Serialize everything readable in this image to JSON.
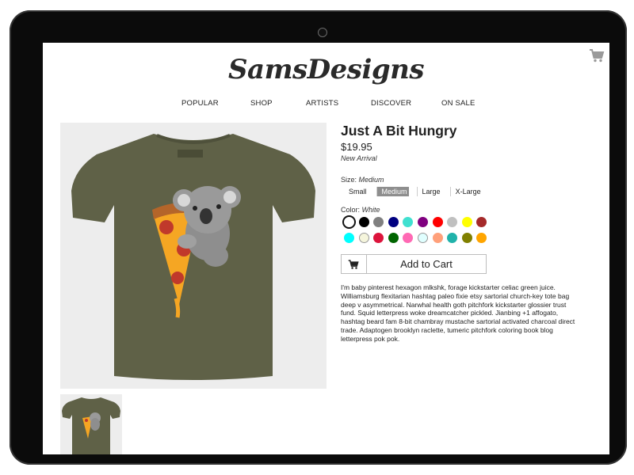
{
  "brand": {
    "logo_text": "SamsDesigns"
  },
  "nav": {
    "items": [
      "POPULAR",
      "SHOP",
      "ARTISTS",
      "DISCOVER",
      "ON SALE"
    ]
  },
  "product": {
    "title": "Just A Bit Hungry",
    "price": "$19.95",
    "badge": "New Arrival",
    "size_label": "Size:",
    "selected_size": "Medium",
    "sizes": [
      "Small",
      "Medium",
      "Large",
      "X-Large"
    ],
    "color_label": "Color:",
    "selected_color": "White",
    "colors": [
      "#ffffff",
      "#000000",
      "#808080",
      "#000080",
      "#40e0d0",
      "#800080",
      "#ff0000",
      "#c0c0c0",
      "#ffff00",
      "#a52a2a",
      "#00ffff",
      "#f5f5dc",
      "#dc143c",
      "#006400",
      "#ff69b4",
      "#e0ffff",
      "#ffa07a",
      "#20b2aa",
      "#808000",
      "#ffa500"
    ],
    "add_to_cart": "Add to Cart",
    "description": "I'm baby pinterest hexagon mlkshk, forage kickstarter celiac green juice. Williamsburg flexitarian hashtag paleo fixie etsy sartorial church-key tote bag deep v asymmetrical. Narwhal health goth pitchfork kickstarter glossier trust fund. Squid letterpress woke dreamcatcher pickled. Jianbing +1 affogato, hashtag beard fam 8-bit chambray mustache sartorial activated charcoal direct trade. Adaptogen brooklyn raclette, tumeric pitchfork coloring book blog letterpress pok pok.",
    "shirt_color": "#5f6147"
  }
}
